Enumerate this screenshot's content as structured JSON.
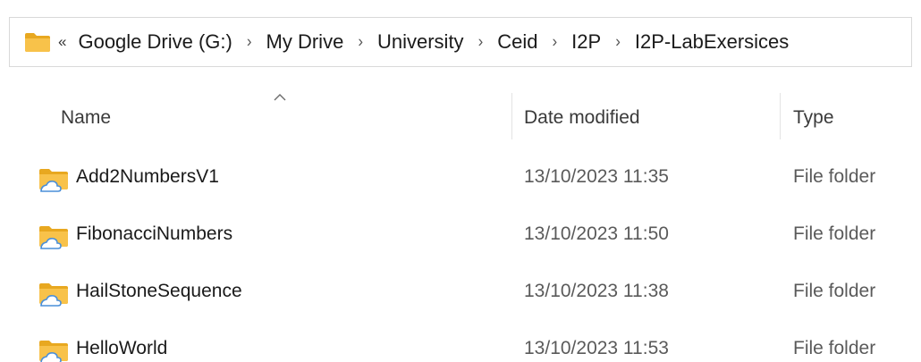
{
  "address_bar": {
    "overflow_glyph": "«",
    "folder_icon": "folder-icon",
    "breadcrumbs": [
      {
        "label": "Google Drive (G:)"
      },
      {
        "label": "My Drive"
      },
      {
        "label": "University"
      },
      {
        "label": "Ceid"
      },
      {
        "label": "I2P"
      },
      {
        "label": "I2P-LabExersices"
      }
    ],
    "separator": "›"
  },
  "columns": {
    "name": "Name",
    "date_modified": "Date modified",
    "type": "Type"
  },
  "rows": [
    {
      "name": "Add2NumbersV1",
      "date": "13/10/2023 11:35",
      "type": "File folder",
      "icon": "cloud-folder-icon"
    },
    {
      "name": "FibonacciNumbers",
      "date": "13/10/2023 11:50",
      "type": "File folder",
      "icon": "cloud-folder-icon"
    },
    {
      "name": "HailStoneSequence",
      "date": "13/10/2023 11:38",
      "type": "File folder",
      "icon": "cloud-folder-icon"
    },
    {
      "name": "HelloWorld",
      "date": "13/10/2023 11:53",
      "type": "File folder",
      "icon": "cloud-folder-icon"
    }
  ],
  "colors": {
    "folder_yellow": "#F8C24A",
    "folder_dark": "#E8A820",
    "cloud_blue": "#4A8FD9",
    "border": "#D9D9D9"
  }
}
